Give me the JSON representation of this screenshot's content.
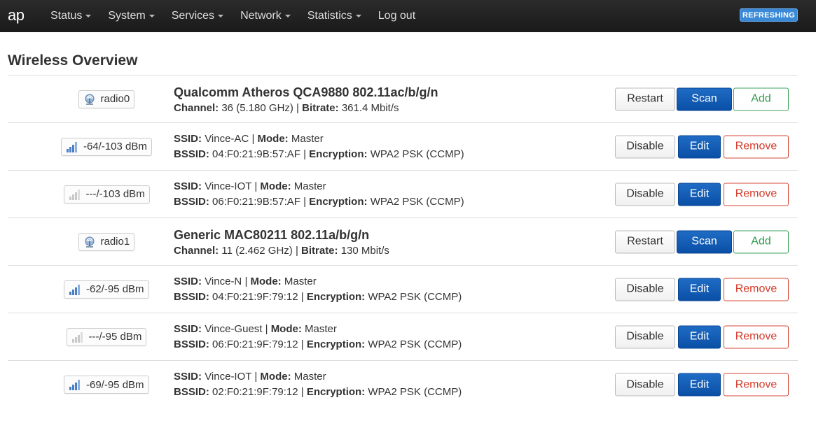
{
  "header": {
    "brand": "ap",
    "menu": [
      {
        "label": "Status",
        "caret": true
      },
      {
        "label": "System",
        "caret": true
      },
      {
        "label": "Services",
        "caret": true
      },
      {
        "label": "Network",
        "caret": true
      },
      {
        "label": "Statistics",
        "caret": true
      },
      {
        "label": "Log out",
        "caret": false
      }
    ],
    "refresh_label": "REFRESHING"
  },
  "page": {
    "title": "Wireless Overview"
  },
  "labels": {
    "channel": "Channel:",
    "bitrate": "Bitrate:",
    "ssid": "SSID:",
    "mode": "Mode:",
    "bssid": "BSSID:",
    "encryption": "Encryption:",
    "sep": " | "
  },
  "buttons": {
    "restart": "Restart",
    "scan": "Scan",
    "add": "Add",
    "disable": "Disable",
    "edit": "Edit",
    "remove": "Remove"
  },
  "rows": [
    {
      "type": "radio",
      "badge": "radio0",
      "title": "Qualcomm Atheros QCA9880 802.11ac/b/g/n",
      "channel": "36 (5.180 GHz)",
      "bitrate": "361.4 Mbit/s"
    },
    {
      "type": "net",
      "badge": "-64/-103 dBm",
      "signal": "good",
      "ssid": "Vince-AC",
      "mode": "Master",
      "bssid": "04:F0:21:9B:57:AF",
      "encryption": "WPA2 PSK (CCMP)"
    },
    {
      "type": "net",
      "badge": "---/-103 dBm",
      "signal": "none",
      "ssid": "Vince-IOT",
      "mode": "Master",
      "bssid": "06:F0:21:9B:57:AF",
      "encryption": "WPA2 PSK (CCMP)"
    },
    {
      "type": "radio",
      "badge": "radio1",
      "title": "Generic MAC80211 802.11a/b/g/n",
      "channel": "11 (2.462 GHz)",
      "bitrate": "130 Mbit/s"
    },
    {
      "type": "net",
      "badge": "-62/-95 dBm",
      "signal": "good",
      "ssid": "Vince-N",
      "mode": "Master",
      "bssid": "04:F0:21:9F:79:12",
      "encryption": "WPA2 PSK (CCMP)"
    },
    {
      "type": "net",
      "badge": "---/-95 dBm",
      "signal": "none",
      "ssid": "Vince-Guest",
      "mode": "Master",
      "bssid": "06:F0:21:9F:79:12",
      "encryption": "WPA2 PSK (CCMP)"
    },
    {
      "type": "net",
      "badge": "-69/-95 dBm",
      "signal": "good",
      "ssid": "Vince-IOT",
      "mode": "Master",
      "bssid": "02:F0:21:9F:79:12",
      "encryption": "WPA2 PSK (CCMP)"
    }
  ],
  "colors": {
    "navbar": "#222222",
    "refresh_badge": "#3a89d6",
    "primary_button": "#0a4fa6",
    "add_button": "#2e9a4c",
    "remove_button": "#d43a2a",
    "signal_good": "#4a7fc4",
    "signal_none": "#c8c8c8"
  }
}
